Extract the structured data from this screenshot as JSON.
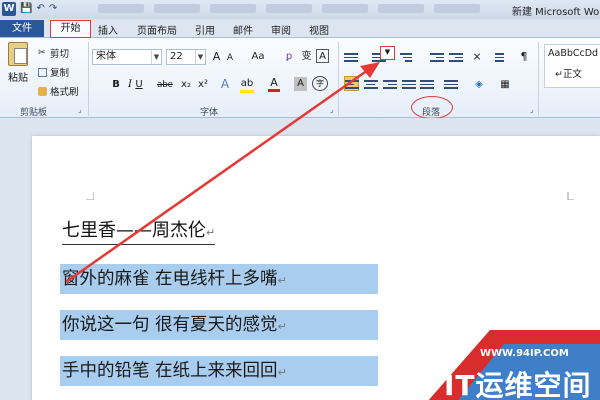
{
  "titlebar": {
    "app_icon": "W",
    "doc_title": "新建 Microsoft Wo"
  },
  "tabs": {
    "file": "文件",
    "home": "开始",
    "insert": "插入",
    "page_layout": "页面布局",
    "references": "引用",
    "mailings": "邮件",
    "review": "审阅",
    "view": "视图"
  },
  "clipboard": {
    "paste": "粘贴",
    "cut": "剪切",
    "copy": "复制",
    "format_painter": "格式刷",
    "group_label": "剪贴板"
  },
  "font": {
    "name": "宋体",
    "size": "22",
    "group_label": "字体",
    "grow": "A",
    "shrink": "A",
    "case": "Aa",
    "clear": "",
    "phonetic": "变",
    "border": "A",
    "bold": "B",
    "italic": "I",
    "underline": "U",
    "strike": "abe",
    "subscript": "x₂",
    "superscript": "x²",
    "text_effect": "A",
    "highlight": "ab",
    "font_color": "A",
    "char_shade": "A",
    "enclose": "字"
  },
  "paragraph": {
    "group_label": "段落"
  },
  "styles": {
    "preview": "AaBbCcDd",
    "normal": "↵正文"
  },
  "document": {
    "heading": "七里香——周杰伦",
    "lines": [
      "窗外的麻雀  在电线杆上多嘴",
      "你说这一句  很有夏天的感觉",
      "手中的铅笔  在纸上来来回回"
    ]
  },
  "watermark": {
    "url": "WWW.94IP.COM",
    "text": "IT运维空间"
  },
  "colors": {
    "file_tab": "#2a579a",
    "highlight_red": "#e03a3a",
    "selection": "#a9cdee"
  }
}
